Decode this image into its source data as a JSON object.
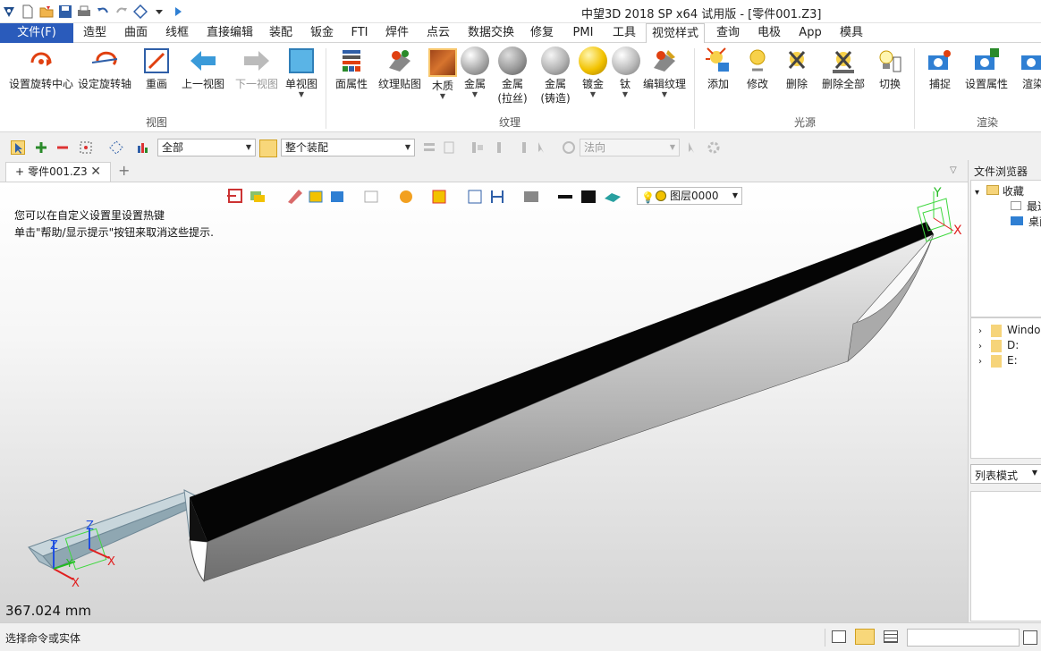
{
  "window": {
    "title": "中望3D 2018 SP x64 试用版 - [零件001.Z3]"
  },
  "menubar": {
    "items": [
      "文件(F)",
      "造型",
      "曲面",
      "线框",
      "直接编辑",
      "装配",
      "钣金",
      "FTI",
      "焊件",
      "点云",
      "数据交换",
      "修复",
      "PMI",
      "工具",
      "视觉样式",
      "查询",
      "电极",
      "App",
      "模具"
    ],
    "active": "视觉样式"
  },
  "ribbon": {
    "view_group": {
      "label": "视图",
      "buttons": [
        "设置旋转中心",
        "设定旋转轴",
        "重画",
        "上一视图",
        "下一视图",
        "单视图"
      ]
    },
    "texture_group": {
      "label": "纹理",
      "buttons": [
        "面属性",
        "纹理贴图",
        "木质",
        "金属",
        "金属\n(拉丝)",
        "金属\n(铸造)",
        "镀金",
        "钛",
        "编辑纹理"
      ]
    },
    "light_group": {
      "label": "光源",
      "buttons": [
        "添加",
        "修改",
        "删除",
        "删除全部",
        "切换"
      ]
    },
    "render_group": {
      "label": "渲染",
      "buttons": [
        "捕捉",
        "设置属性",
        "渲染"
      ]
    }
  },
  "toolbar2": {
    "filter": "全部",
    "scope": "整个装配",
    "direction": "法向"
  },
  "doctabs": {
    "active": "零件001.Z3"
  },
  "viewport": {
    "hint_line1": "您可以在自定义设置里设置热键",
    "hint_line2": "单击\"帮助/显示提示\"按钮来取消这些提示.",
    "layer": "图层0000",
    "measurement": "367.024 mm",
    "axis_x": "X",
    "axis_y": "Y",
    "axis_z": "Z"
  },
  "browser": {
    "title": "文件浏览器",
    "favorites": "收藏",
    "fav_items": [
      "最近",
      "桌面"
    ],
    "drives": [
      "Windows",
      "D:",
      "E:"
    ],
    "view_mode": "列表模式"
  },
  "status": {
    "text": "选择命令或实体"
  },
  "colors": {
    "accent": "#2a5bbb",
    "blade": "#050505",
    "grip": "#b7c6cc"
  }
}
